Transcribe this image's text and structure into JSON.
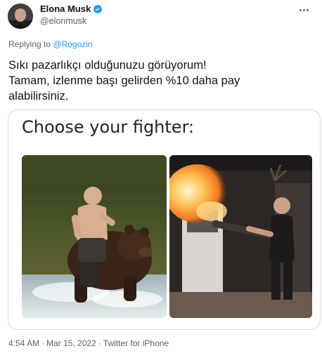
{
  "author": {
    "display_name": "Elona Musk",
    "handle": "@elonmusk",
    "verified": true
  },
  "reply": {
    "prefix": "Replying to",
    "mention": "@Rogozin"
  },
  "tweet": {
    "lines": [
      "Sıkı pazarlıkçı olduğunuzu görüyorum!",
      "Tamam, izlenme başı gelirden %10 daha pay",
      "alabilirsiniz."
    ]
  },
  "media": {
    "meme_title": "Choose your fighter:",
    "left_image": "shirtless-man-riding-bear-photo",
    "right_image": "man-with-flamethrower-photo"
  },
  "meta": {
    "time": "4:54 AM",
    "date": "Mar 15, 2022",
    "source": "Twitter for iPhone",
    "separator": "·"
  },
  "icons": {
    "verified": "verified-badge-icon",
    "more": "more-options-icon"
  },
  "colors": {
    "accent": "#1d9bf0",
    "secondary_text": "#536471",
    "border": "#cfd9de"
  }
}
